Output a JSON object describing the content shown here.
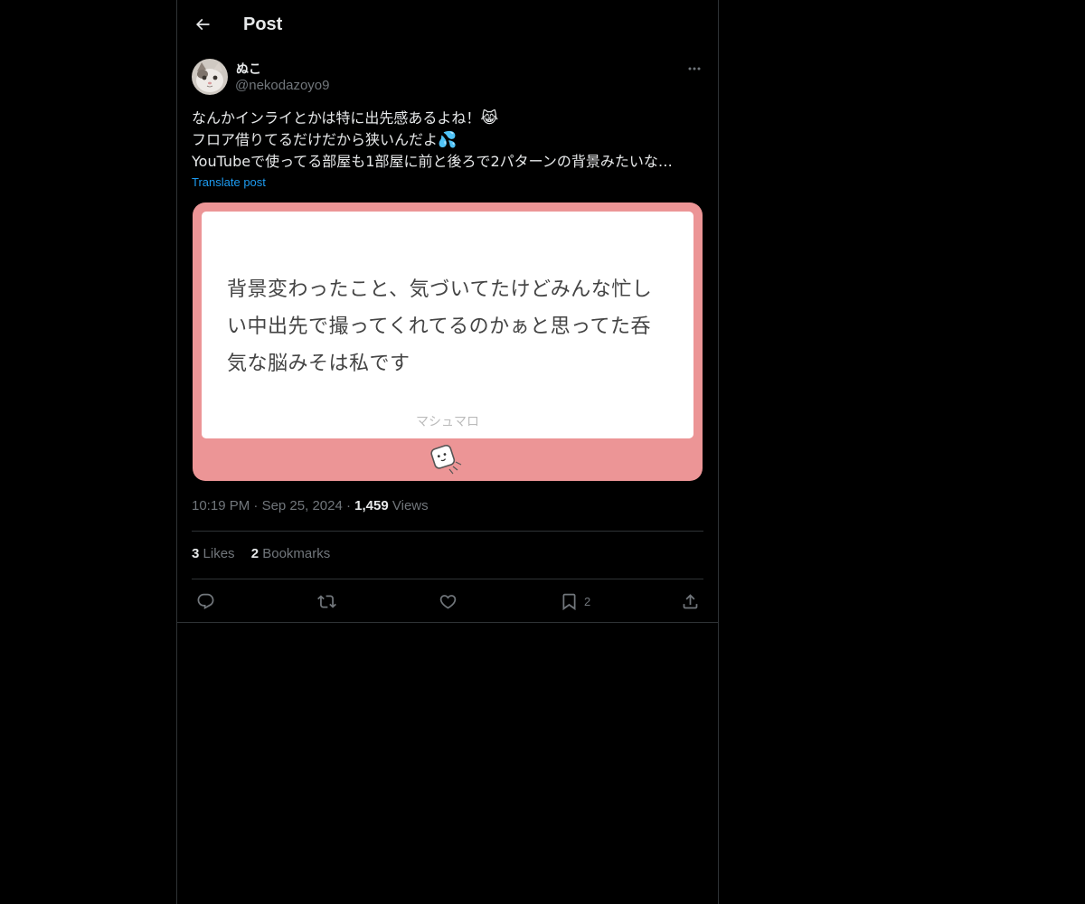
{
  "header": {
    "title": "Post"
  },
  "author": {
    "display_name": "ぬこ",
    "handle": "@nekodazoyo9"
  },
  "post": {
    "lines": [
      "なんかインライとかは特に出先感あるよね！",
      "フロア借りてるだけだから狭いんだよ",
      "YouTubeで使ってる部屋も1部屋に前と後ろで2パターンの背景みたいな…"
    ],
    "emojis": [
      "😹",
      "💦"
    ],
    "translate_label": "Translate post"
  },
  "card": {
    "question_lines": [
      "背景変わったこと、気づいてたけどみんな忙し",
      "い中出先で撮ってくれてるのかぁと思ってた呑",
      "気な脳みそは私です"
    ],
    "brand": "マシュマロ",
    "background_color": "#ec9596"
  },
  "meta": {
    "time": "10:19 PM",
    "date": "Sep 25, 2024",
    "views_count": "1,459",
    "views_label": "Views",
    "separator": "·"
  },
  "stats": {
    "likes_count": "3",
    "likes_label": "Likes",
    "bookmarks_count": "2",
    "bookmarks_label": "Bookmarks"
  },
  "actions": {
    "reply_icon": "reply-icon",
    "repost_icon": "repost-icon",
    "like_icon": "heart-icon",
    "bookmark_icon": "bookmark-icon",
    "bookmark_count": "2",
    "share_icon": "share-icon"
  },
  "colors": {
    "background": "#000000",
    "text": "#e7e9ea",
    "muted": "#71767b",
    "accent": "#1d9bf0",
    "border": "#2f3336"
  }
}
